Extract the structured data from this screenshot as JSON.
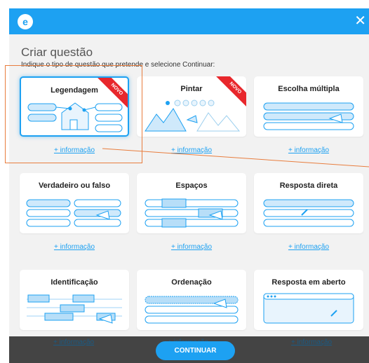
{
  "header": {
    "logo": "e",
    "close_icon": "close-icon"
  },
  "page": {
    "title": "Criar questão",
    "subtitle": "Indique o tipo de questão que pretende e selecione Continuar:"
  },
  "cards": [
    {
      "title": "Legendagem",
      "info": "+ informação",
      "ribbon": "NOVO",
      "icon": "captioning-icon"
    },
    {
      "title": "Pintar",
      "info": "+ informação",
      "ribbon": "NOVO",
      "icon": "paint-icon"
    },
    {
      "title": "Escolha múltipla",
      "info": "+ informação",
      "icon": "multiple-choice-icon"
    },
    {
      "title": "Verdadeiro ou falso",
      "info": "+ informação",
      "icon": "true-false-icon"
    },
    {
      "title": "Espaços",
      "info": "+ informação",
      "icon": "gaps-icon"
    },
    {
      "title": "Resposta direta",
      "info": "+ informação",
      "icon": "direct-answer-icon"
    },
    {
      "title": "Identificação",
      "info": "+ informação",
      "icon": "identification-icon"
    },
    {
      "title": "Ordenação",
      "info": "+ informação",
      "icon": "ordering-icon"
    },
    {
      "title": "Resposta em aberto",
      "info": "+ informação",
      "icon": "open-answer-icon"
    }
  ],
  "footer": {
    "continue_label": "CONTINUAR"
  },
  "colors": {
    "accent": "#1da1f2",
    "ribbon": "#e8272c",
    "highlight": "#e87d3e",
    "footer": "#444444"
  }
}
